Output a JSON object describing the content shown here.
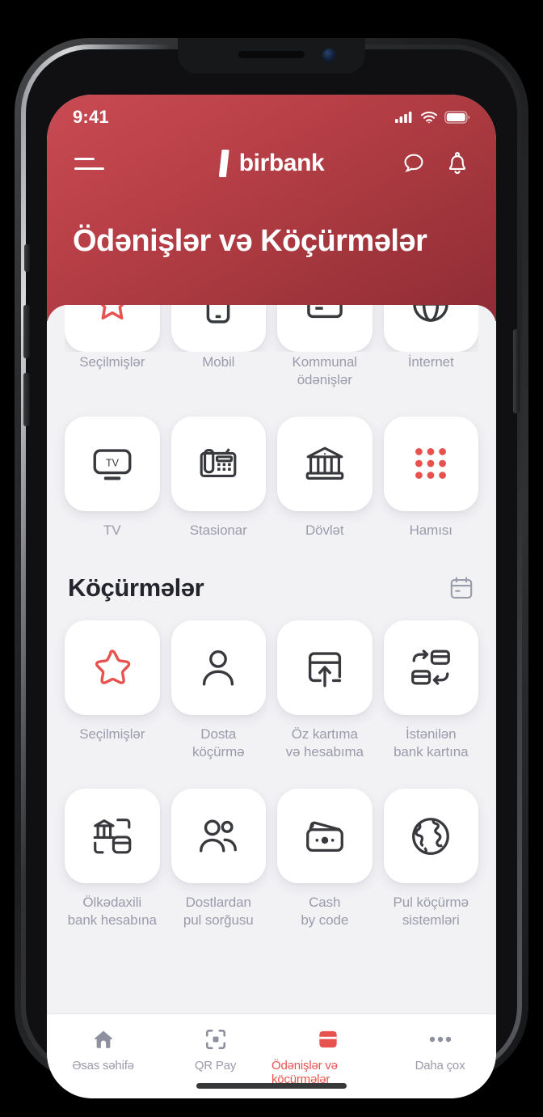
{
  "status_bar": {
    "time": "9:41",
    "signal_icon": "cellular-signal-icon",
    "wifi_icon": "wifi-icon",
    "battery_icon": "battery-icon"
  },
  "header": {
    "menu_icon": "hamburger-menu-icon",
    "brand": "birbank",
    "chat_icon": "chat-bubble-icon",
    "bell_icon": "notification-bell-icon",
    "title": "Ödənişlər və Köçürmələr",
    "gradient_from": "#c94a52",
    "gradient_to": "#8e2c35"
  },
  "payments": {
    "row_partial": [
      {
        "label": "Seçilmişlər",
        "icon": "star-icon"
      },
      {
        "label": "Mobil",
        "icon": "mobile-phone-icon"
      },
      {
        "label": "Kommunal\nödənişlər",
        "icon": "utilities-icon"
      },
      {
        "label": "İnternet",
        "icon": "internet-globe-icon"
      }
    ],
    "row_two": [
      {
        "label": "TV",
        "icon": "tv-icon"
      },
      {
        "label": "Stasionar",
        "icon": "landline-phone-icon"
      },
      {
        "label": "Dövlət",
        "icon": "government-building-icon"
      },
      {
        "label": "Hamısı",
        "icon": "grid-dots-icon"
      }
    ]
  },
  "transfers": {
    "title": "Köçürmələr",
    "history_icon": "calendar-icon",
    "row_one": [
      {
        "label": "Seçilmişlər",
        "icon": "star-outline-icon"
      },
      {
        "label": "Dosta\nköçürmə",
        "icon": "person-icon"
      },
      {
        "label": "Öz kartıma\nvə hesabıma",
        "icon": "card-arrow-up-icon"
      },
      {
        "label": "İstənilən\nbank kartına",
        "icon": "card-swap-icon"
      }
    ],
    "row_two": [
      {
        "label": "Ölkədaxili\nbank hesabına",
        "icon": "bank-to-card-icon"
      },
      {
        "label": "Dostlardan\npul sorğusu",
        "icon": "two-people-icon"
      },
      {
        "label": "Cash\nby code",
        "icon": "wallet-icon"
      },
      {
        "label": "Pul köçürmə\nsistemləri",
        "icon": "globe-icon"
      }
    ]
  },
  "tabbar": {
    "active_color": "#e8524e",
    "items": [
      {
        "label": "Əsas səhifə",
        "icon": "home-icon",
        "active": false
      },
      {
        "label": "QR Pay",
        "icon": "qr-scan-icon",
        "active": false
      },
      {
        "label": "Ödənişlər və köçürmələr",
        "icon": "credit-card-icon",
        "active": true
      },
      {
        "label": "Daha çox",
        "icon": "more-dots-icon",
        "active": false
      }
    ]
  }
}
